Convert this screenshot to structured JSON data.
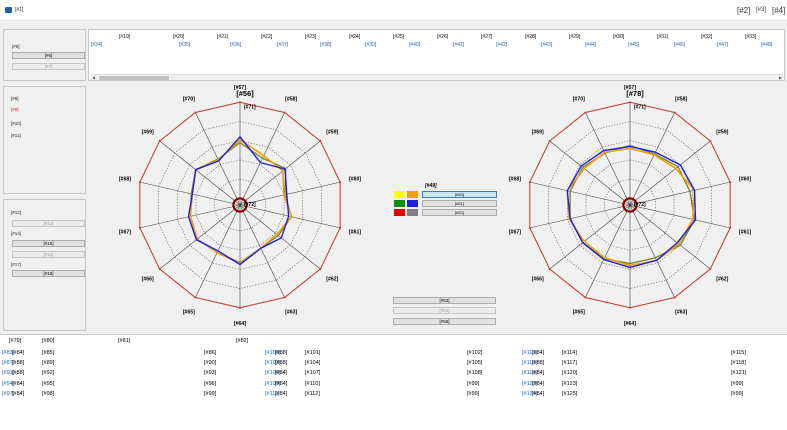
{
  "window": {
    "title": "[#1]",
    "minimize": "[#2]",
    "maximize": "[#3]",
    "close": "[#4]"
  },
  "left": {
    "load_group": "[#5]",
    "open_file": "[#6]",
    "load_to_table": "[#7]",
    "defects_group": "[#8]",
    "warning": "[#9]",
    "accuracy_label": "[#10]",
    "accuracy_value": "[#11]",
    "nn_group": "[#12]",
    "analyze": "[#13]",
    "db_group": "[#14]",
    "connect_db": "[#15]",
    "upload_data": "[#16]",
    "details_group": "[#17]",
    "show_data": "[#18]"
  },
  "grid": {
    "headers": [
      "[#19]",
      "[#20]",
      "[#21]",
      "[#22]",
      "[#23]",
      "[#24]",
      "[#25]",
      "[#26]",
      "[#27]",
      "[#28]",
      "[#29]",
      "[#30]",
      "[#31]",
      "[#32]",
      "[#33]"
    ],
    "row": [
      "[#34]",
      "[#35]",
      "[#36]",
      "[#37]",
      "[#38]",
      "[#39]",
      "[#40]",
      "[#41]",
      "[#42]",
      "[#43]",
      "[#44]",
      "[#45]",
      "[#46]",
      "[#47]",
      "[#48]"
    ]
  },
  "legend": {
    "title": "[#49]",
    "phase_a": "[#50]",
    "phase_b": "[#51]",
    "phase_c": "[#52]"
  },
  "actions": {
    "save": "[#53]",
    "compare": "[#54]",
    "clear": "[#55]"
  },
  "colors": {
    "phase_a": "#f0a000",
    "phase_b": "#2020e0",
    "phase_c": "#7a8a2a",
    "limit": "#c0392b",
    "min_ring": "#8b0000"
  },
  "chart_data": [
    {
      "type": "radar",
      "title": "[#56]",
      "axes": [
        "[#57]",
        "[#58]",
        "[#59]",
        "[#60]",
        "[#61]",
        "[#62]",
        "[#63]",
        "[#64]",
        "[#65]",
        "[#66]",
        "[#67]",
        "[#68]",
        "[#69]",
        "[#70]"
      ],
      "ring_labels": [
        "[#71]",
        "[#72]"
      ],
      "rlim": [
        -120,
        -20
      ],
      "series": [
        {
          "name": "[#73]",
          "values": [
            -59,
            -70,
            -70,
            -80,
            -72,
            -78,
            -77,
            -66,
            -72,
            -70,
            -74,
            -76,
            -68,
            -75
          ]
        },
        {
          "name": "[#74]",
          "values": [
            -56,
            -78,
            -67,
            -77,
            -75,
            -72,
            -77,
            -65,
            -74,
            -69,
            -72,
            -76,
            -68,
            -76
          ]
        },
        {
          "name": "[#75]",
          "values": [
            -62,
            -73,
            -66,
            -79,
            -72,
            -76,
            -77,
            -67,
            -72,
            -70,
            -74,
            -75,
            -68,
            -74
          ]
        },
        {
          "name": "[#76]",
          "values": [
            -20,
            -20,
            -20,
            -20,
            -20,
            -20,
            -20,
            -20,
            -20,
            -20,
            -20,
            -20,
            -20,
            -20
          ]
        },
        {
          "name": "[#77]",
          "values": [
            -120,
            -120,
            -120,
            -120,
            -120,
            -120,
            -120,
            -120,
            -120,
            -120,
            -120,
            -120,
            -120,
            -120
          ]
        }
      ]
    },
    {
      "type": "radar",
      "title": "[#78]",
      "axes": [
        "[#57]",
        "[#58]",
        "[#59]",
        "[#60]",
        "[#61]",
        "[#62]",
        "[#63]",
        "[#64]",
        "[#65]",
        "[#66]",
        "[#67]",
        "[#68]",
        "[#69]",
        "[#70]"
      ],
      "ring_labels": [
        "[#71]",
        "[#72]"
      ],
      "rlim": [
        -120,
        -20
      ],
      "series": [
        {
          "name": "[#73]",
          "values": [
            -68,
            -69,
            -66,
            -58,
            -60,
            -62,
            -63,
            -64,
            -66,
            -66,
            -62,
            -60,
            -66,
            -66
          ]
        },
        {
          "name": "[#74]",
          "values": [
            -66,
            -66,
            -60,
            -58,
            -57,
            -64,
            -63,
            -62,
            -64,
            -64,
            -63,
            -60,
            -62,
            -64
          ]
        },
        {
          "name": "[#75]",
          "values": [
            -65,
            -68,
            -63,
            -63,
            -58,
            -60,
            -66,
            -66,
            -65,
            -64,
            -63,
            -63,
            -64,
            -67
          ]
        },
        {
          "name": "[#76]",
          "values": [
            -20,
            -20,
            -20,
            -20,
            -20,
            -20,
            -20,
            -20,
            -20,
            -20,
            -20,
            -20,
            -20,
            -20
          ]
        },
        {
          "name": "[#77]",
          "values": [
            -120,
            -120,
            -120,
            -120,
            -120,
            -120,
            -120,
            -120,
            -120,
            -120,
            -120,
            -120,
            -120,
            -120
          ]
        }
      ]
    }
  ],
  "defects": {
    "headers": {
      "n": "[#79]",
      "type": "[#80]",
      "desc": "[#81]",
      "pct": "[#82]"
    },
    "rows": [
      [
        {
          "n": "[#83]",
          "type": "[#84]",
          "desc": "[#85]",
          "pct": "[#86]"
        },
        {
          "n": "[#87]",
          "type": "[#88]",
          "desc": "[#89]",
          "pct": "[#90]"
        },
        {
          "n": "[#91]",
          "type": "[#88]",
          "desc": "[#92]",
          "pct": "[#93]"
        },
        {
          "n": "[#94]",
          "type": "[#84]",
          "desc": "[#95]",
          "pct": "[#96]"
        },
        {
          "n": "[#97]",
          "type": "[#84]",
          "desc": "[#98]",
          "pct": "[#99]"
        }
      ],
      [
        {
          "n": "[#100]",
          "type": "[#88]",
          "desc": "[#101]",
          "pct": "[#102]"
        },
        {
          "n": "[#103]",
          "type": "[#88]",
          "desc": "[#104]",
          "pct": "[#105]"
        },
        {
          "n": "[#106]",
          "type": "[#84]",
          "desc": "[#107]",
          "pct": "[#108]"
        },
        {
          "n": "[#109]",
          "type": "[#84]",
          "desc": "[#110]",
          "pct": "[#99]"
        },
        {
          "n": "[#111]",
          "type": "[#84]",
          "desc": "[#112]",
          "pct": "[#99]"
        }
      ],
      [
        {
          "n": "[#113]",
          "type": "[#84]",
          "desc": "[#114]",
          "pct": "[#115]"
        },
        {
          "n": "[#116]",
          "type": "[#88]",
          "desc": "[#117]",
          "pct": "[#118]"
        },
        {
          "n": "[#119]",
          "type": "[#84]",
          "desc": "[#120]",
          "pct": "[#121]"
        },
        {
          "n": "[#122]",
          "type": "[#84]",
          "desc": "[#123]",
          "pct": "[#99]"
        },
        {
          "n": "[#124]",
          "type": "[#84]",
          "desc": "[#125]",
          "pct": "[#99]"
        }
      ]
    ]
  }
}
